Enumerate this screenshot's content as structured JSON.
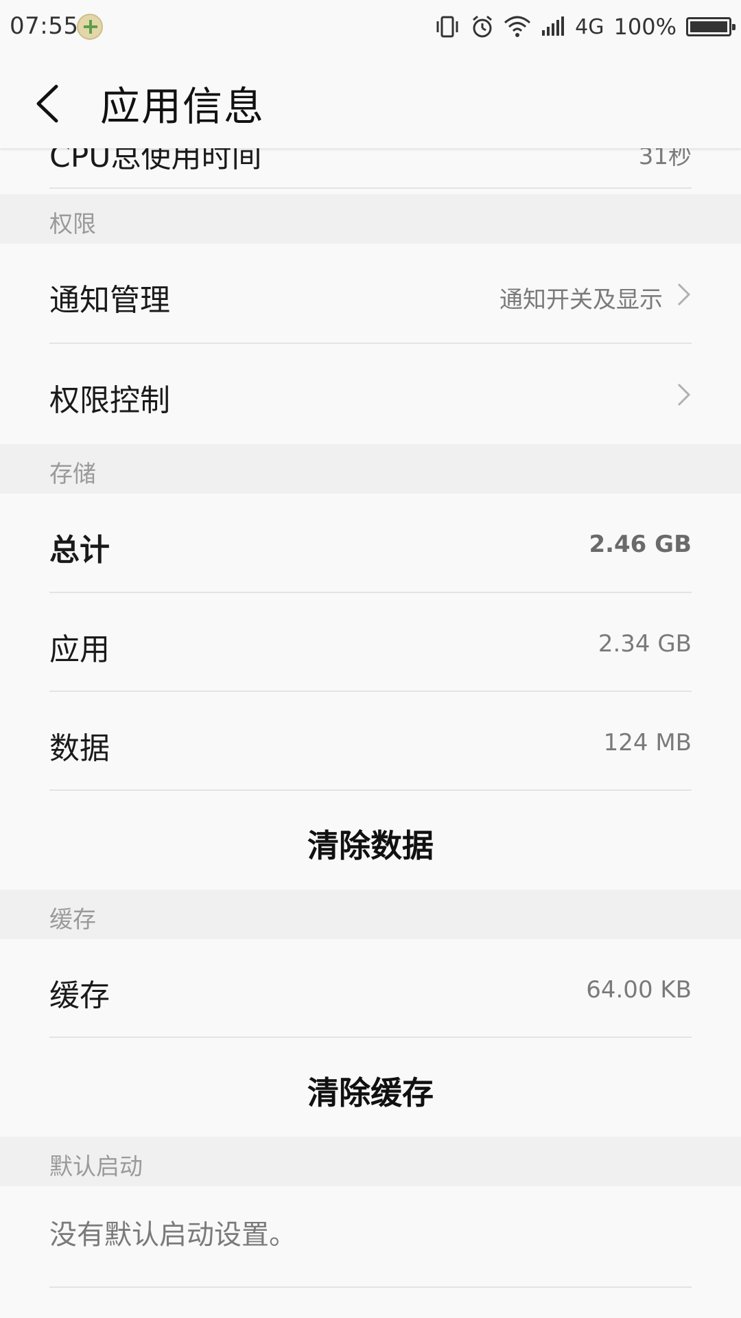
{
  "status_bar": {
    "time": "07:55",
    "network": "4G",
    "battery": "100%",
    "icons": [
      "vibrate-icon",
      "alarm-icon",
      "wifi-icon",
      "signal-icon",
      "battery-icon"
    ]
  },
  "header": {
    "title": "应用信息"
  },
  "rows": {
    "cpu_partial": {
      "label": "CPU总使用时间",
      "value": "31秒"
    },
    "notification": {
      "label": "通知管理",
      "value": "通知开关及显示"
    },
    "permission_control": {
      "label": "权限控制"
    },
    "total": {
      "label": "总计",
      "value": "2.46 GB"
    },
    "app": {
      "label": "应用",
      "value": "2.34 GB"
    },
    "data": {
      "label": "数据",
      "value": "124 MB"
    },
    "clear_data": {
      "label": "清除数据"
    },
    "cache": {
      "label": "缓存",
      "value": "64.00 KB"
    },
    "clear_cache": {
      "label": "清除缓存"
    },
    "default_launch_text": {
      "label": "没有默认启动设置。"
    }
  },
  "sections": {
    "permissions": "权限",
    "storage": "存储",
    "cache": "缓存",
    "default_launch": "默认启动"
  },
  "colors": {
    "background": "#f9f9f9",
    "section_background": "#f0f0f0",
    "secondary_text": "#7a7a7a"
  }
}
